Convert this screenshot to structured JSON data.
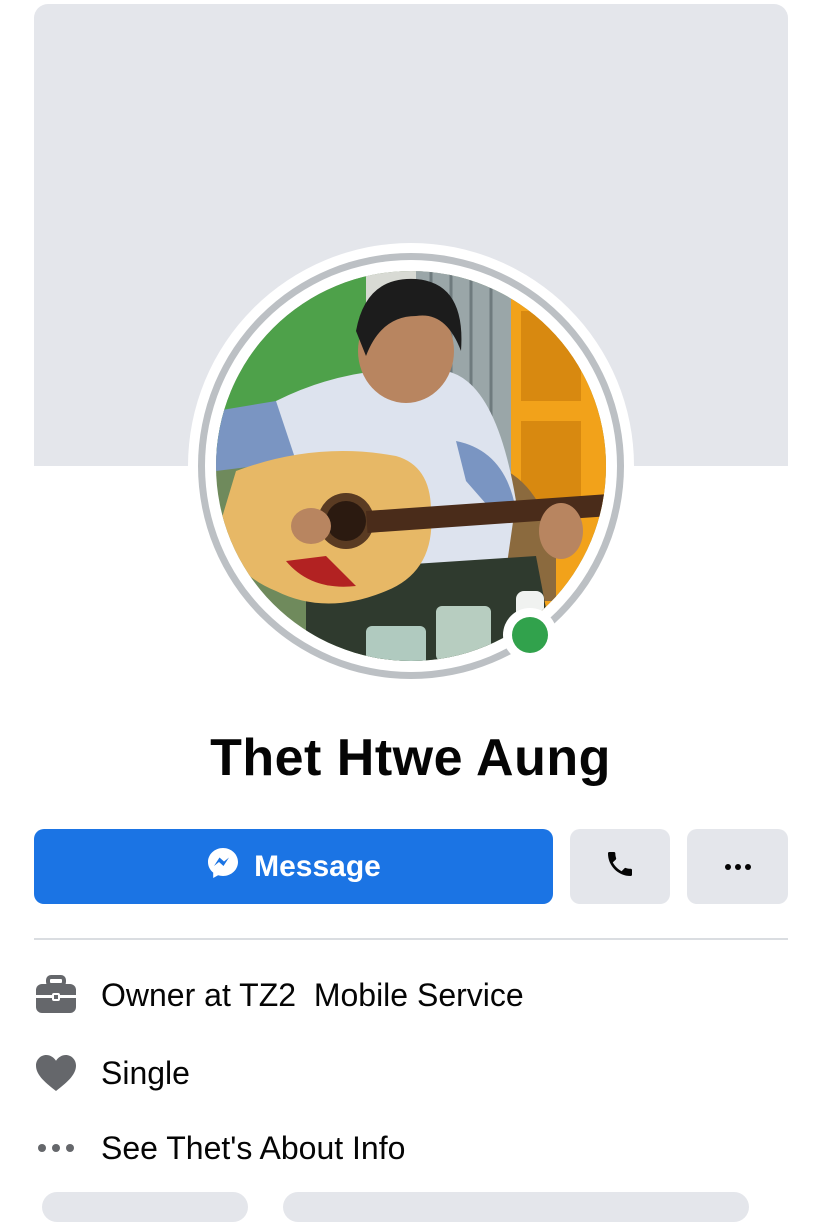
{
  "profile": {
    "name": "Thet Htwe Aung",
    "online": true
  },
  "actions": {
    "message_label": "Message",
    "call_icon": "phone-icon",
    "more_icon": "more-icon"
  },
  "info": [
    {
      "icon": "briefcase-icon",
      "text": "Owner at TZ2  Mobile Service"
    },
    {
      "icon": "heart-icon",
      "text": "Single"
    },
    {
      "icon": "ellipsis-icon",
      "text": "See Thet's About Info"
    }
  ],
  "colors": {
    "primary": "#1b74e4",
    "online": "#31a24c",
    "cover": "#e4e6eb",
    "icon_grey": "#8a8d91"
  }
}
